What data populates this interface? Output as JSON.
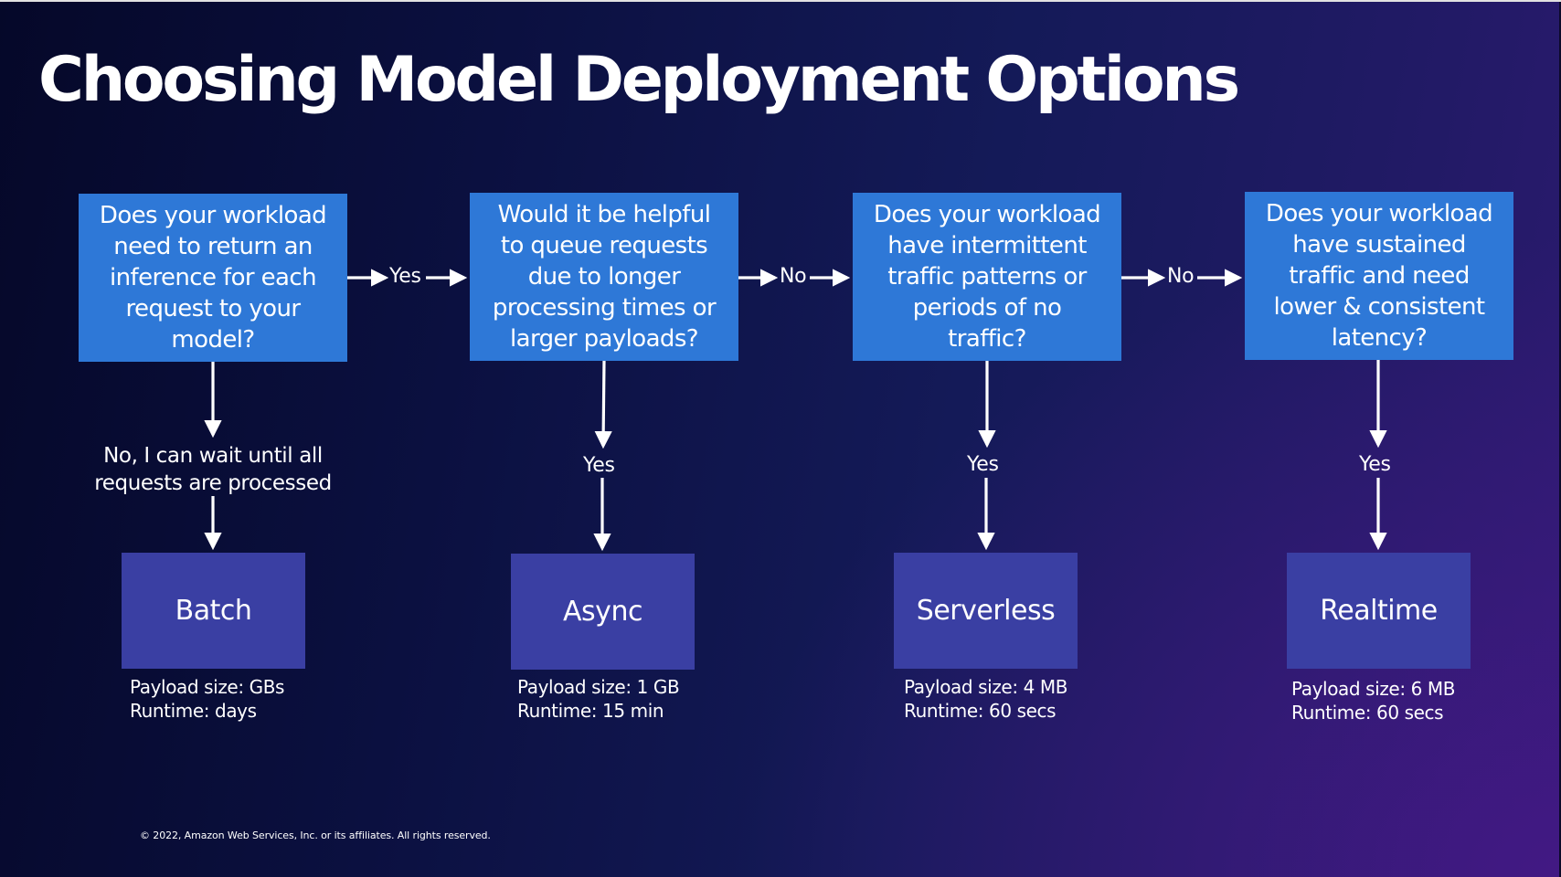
{
  "slide": {
    "title": "Choosing Model Deployment Options",
    "footer": "© 2022, Amazon Web Services, Inc. or its affiliates. All rights reserved."
  },
  "colors": {
    "question_box": "#2e78d7",
    "result_box": "#3a3fa3",
    "arrow": "#ffffff",
    "background_start": "#050829",
    "background_end": "#3d1a7a"
  },
  "questions": [
    {
      "text": "Does your workload\nneed to return an\ninference for each\nrequest to your\nmodel?"
    },
    {
      "text": "Would it be helpful\nto queue requests\ndue to longer\nprocessing times or\nlarger payloads?"
    },
    {
      "text": "Does your workload\nhave intermittent\ntraffic patterns or\nperiods of no\ntraffic?"
    },
    {
      "text": "Does your workload\nhave sustained\ntraffic and need\nlower & consistent\nlatency?"
    }
  ],
  "horizontal_edges": [
    {
      "from": 0,
      "to": 1,
      "label": "Yes"
    },
    {
      "from": 1,
      "to": 2,
      "label": "No"
    },
    {
      "from": 2,
      "to": 3,
      "label": "No"
    }
  ],
  "vertical_edges": [
    {
      "from": 0,
      "label": "No, I can wait until all\nrequests are processed"
    },
    {
      "from": 1,
      "label": "Yes"
    },
    {
      "from": 2,
      "label": "Yes"
    },
    {
      "from": 3,
      "label": "Yes"
    }
  ],
  "results": [
    {
      "name": "Batch",
      "payload": "Payload size: GBs",
      "runtime": "Runtime: days"
    },
    {
      "name": "Async",
      "payload": "Payload size: 1 GB",
      "runtime": "Runtime: 15 min"
    },
    {
      "name": "Serverless",
      "payload": "Payload size: 4 MB",
      "runtime": "Runtime: 60 secs"
    },
    {
      "name": "Realtime",
      "payload": "Payload size: 6 MB",
      "runtime": "Runtime: 60 secs"
    }
  ]
}
